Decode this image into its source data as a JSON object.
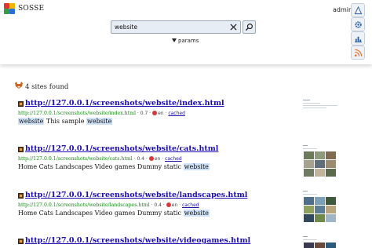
{
  "app": {
    "name": "SOSSE",
    "user": "admin"
  },
  "search": {
    "query": "website",
    "params_label": "params"
  },
  "results": {
    "summary": "4 sites found",
    "items": [
      {
        "title": "http://127.0.0.1/screenshots/website/index.html",
        "url": "http://127.0.0.1/screenshots/website/index.html",
        "score": "0.7",
        "lang": "en",
        "cached_label": "cached",
        "snippet": [
          "website",
          " This sample ",
          "website"
        ]
      },
      {
        "title": "http://127.0.0.1/screenshots/website/cats.html",
        "url": "http://127.0.0.1/screenshots/website/cats.html",
        "score": "0.4",
        "lang": "en",
        "cached_label": "cached",
        "snippet": [
          "Home Cats Landscapes Video games Dummy static ",
          "website",
          ""
        ]
      },
      {
        "title": "http://127.0.0.1/screenshots/website/landscapes.html",
        "url": "http://127.0.0.1/screenshots/website/landscapes.html",
        "score": "0.4",
        "lang": "en",
        "cached_label": "cached",
        "snippet": [
          "Home Cats Landscapes Video games Dummy static ",
          "website",
          ""
        ]
      },
      {
        "title": "http://127.0.0.1/screenshots/website/videogames.html"
      }
    ]
  },
  "icons": {
    "logo": "sosse-logo-icon",
    "clear": "close-icon",
    "search": "search-icon",
    "side": [
      "user-icon",
      "gear-icon",
      "stats-icon",
      "rss-icon"
    ]
  },
  "colors": {
    "link": "#1a0dab",
    "url": "#138a13",
    "highlight": "#cfe2f7",
    "search_bg": "#e6edf4",
    "logo": [
      "#e5322d",
      "#f5b400",
      "#2f9e44",
      "#2a6fdb"
    ]
  }
}
